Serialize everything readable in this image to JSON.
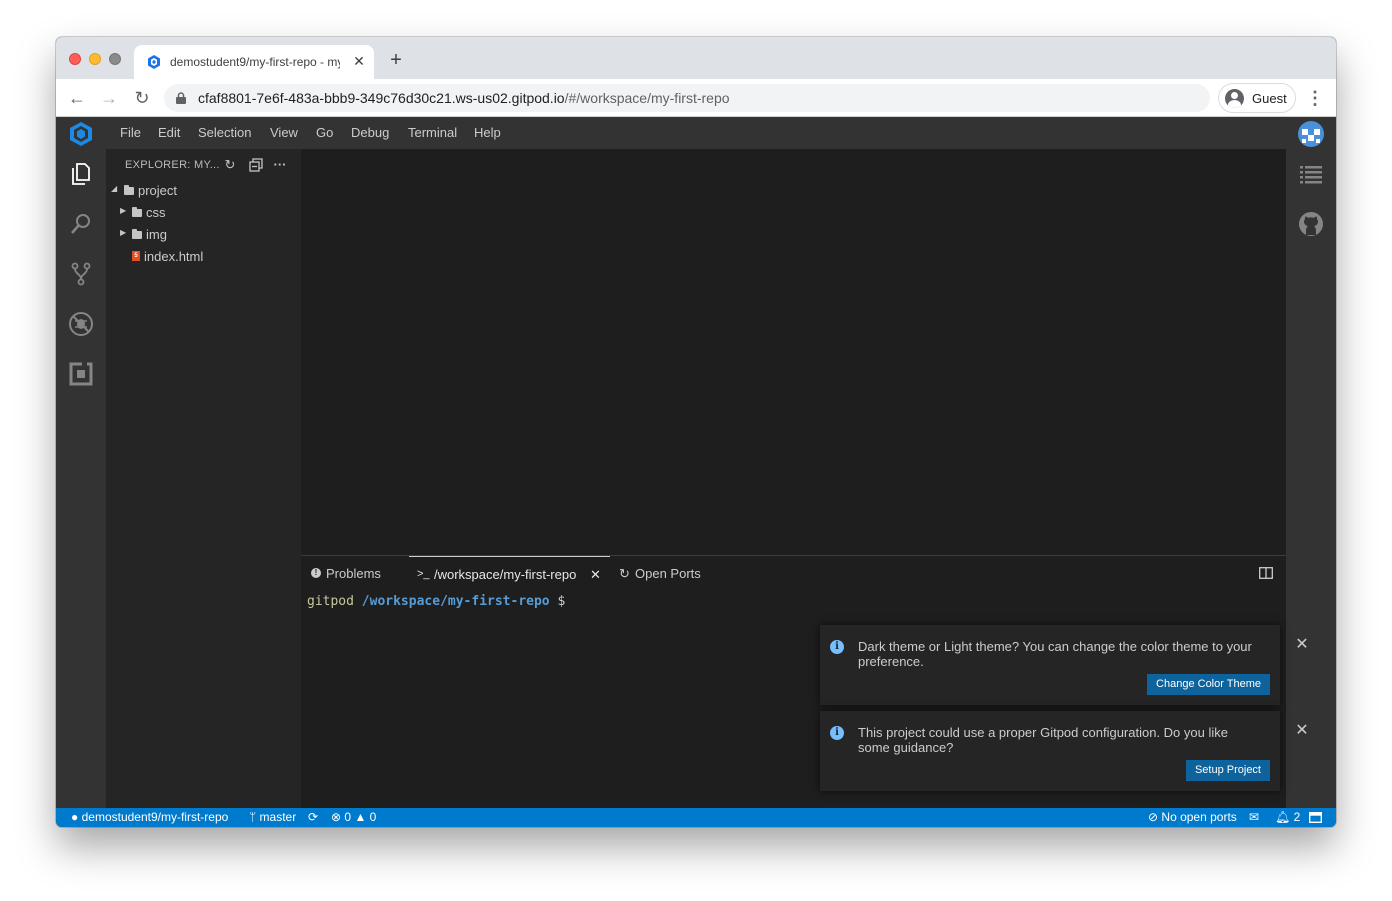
{
  "browser": {
    "tab_title": "demostudent9/my-first-repo - my-first-repo",
    "url_main": "cfaf8801-7e6f-483a-bbb9-349c76d30c21.ws-us02.gitpod.io",
    "url_path": "/#/workspace/my-first-repo",
    "profile_label": "Guest"
  },
  "menu": [
    "File",
    "Edit",
    "Selection",
    "View",
    "Go",
    "Debug",
    "Terminal",
    "Help"
  ],
  "explorer": {
    "title": "EXPLORER: MY...",
    "tree": [
      {
        "label": "project",
        "type": "folder",
        "expanded": true,
        "depth": 0
      },
      {
        "label": "css",
        "type": "folder",
        "expanded": false,
        "depth": 1
      },
      {
        "label": "img",
        "type": "folder",
        "expanded": false,
        "depth": 1
      },
      {
        "label": "index.html",
        "type": "file",
        "depth": 1
      }
    ]
  },
  "panel": {
    "tabs": [
      {
        "label": "Problems",
        "icon": "problems-icon"
      },
      {
        "label": "/workspace/my-first-repo",
        "icon": "terminal-icon",
        "active": true
      },
      {
        "label": "Open Ports",
        "icon": "ports-icon"
      }
    ],
    "terminal": {
      "host": "gitpod",
      "path": "/workspace/my-first-repo",
      "prompt": "$"
    }
  },
  "notifications": [
    {
      "text": "Dark theme or Light theme? You can change the color theme to your preference.",
      "button": "Change Color Theme"
    },
    {
      "text": "This project could use a proper Gitpod configuration. Do you like some guidance?",
      "button": "Setup Project"
    }
  ],
  "status": {
    "repo": "demostudent9/my-first-repo",
    "branch": "master",
    "errors": "0",
    "warnings": "0",
    "ports": "No open ports",
    "notifications_count": "2"
  },
  "colors": {
    "accent": "#007acc",
    "button": "#0e639c",
    "terminal_host": "#c8c8a0",
    "terminal_path": "#569cd6"
  }
}
